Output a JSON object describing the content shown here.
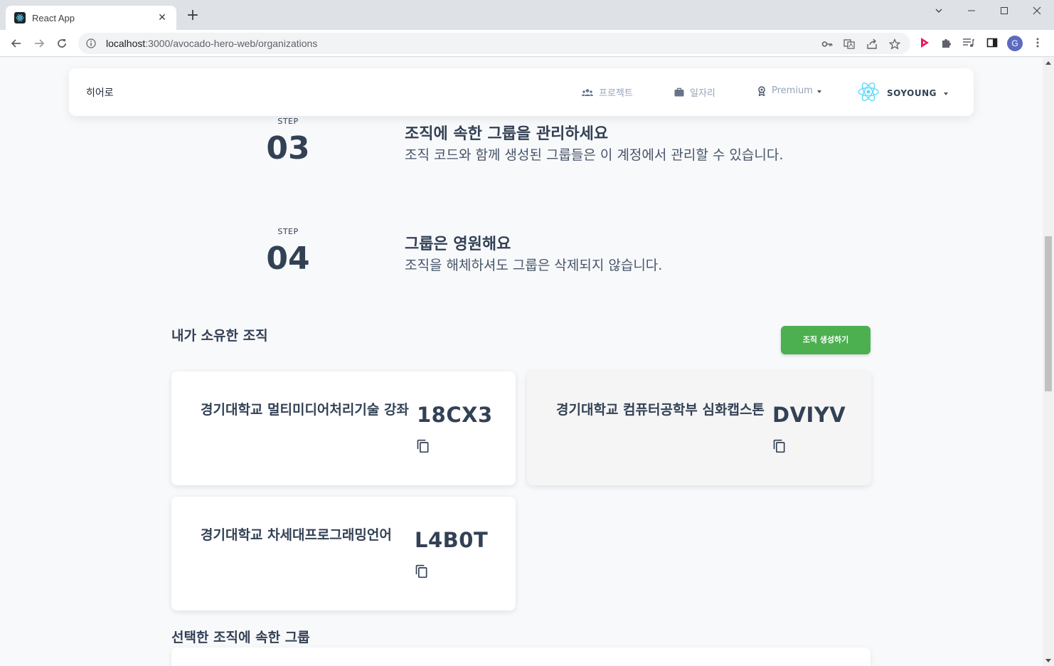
{
  "browser": {
    "tab_title": "React App",
    "tab_close": "✕",
    "new_tab": "+",
    "url_host": "localhost",
    "url_path": ":3000/avocado-hero-web/organizations",
    "profile_initial": "G"
  },
  "header": {
    "brand": "히어로",
    "nav": {
      "projects": "프로젝트",
      "jobs": "일자리",
      "premium": "Premium"
    },
    "user_name": "SOYOUNG"
  },
  "steps": [
    {
      "label": "STEP",
      "number": "03",
      "title": "조직에 속한 그룹을 관리하세요",
      "desc": "조직 코드와 함께 생성된 그룹들은 이 계정에서 관리할 수 있습니다."
    },
    {
      "label": "STEP",
      "number": "04",
      "title": "그룹은 영원해요",
      "desc": "조직을 해체하셔도 그룹은 삭제되지 않습니다."
    }
  ],
  "my_orgs": {
    "title": "내가 소유한 조직",
    "create_button": "조직 생성하기",
    "cards": [
      {
        "name": "경기대학교 멀티미디어처리기술 강좌",
        "code": "18CX3"
      },
      {
        "name": "경기대학교 컴퓨터공학부 심화캡스톤",
        "code": "DVIYV"
      },
      {
        "name": "경기대학교 차세대프로그래밍언어",
        "code": "L4B0T"
      }
    ]
  },
  "groups_section": {
    "title": "선택한 조직에 속한 그룹"
  },
  "colors": {
    "accent_green": "#4caf50",
    "text_dark": "#334155",
    "react_cyan": "#61dafb"
  }
}
